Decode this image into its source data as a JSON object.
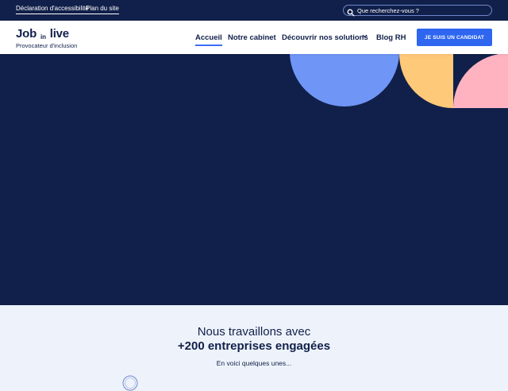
{
  "topbar": {
    "links": [
      "Déclaration d'accessibilité",
      "Plan du site"
    ],
    "search_placeholder": "Que recherchez-vous ?",
    "search_value": ""
  },
  "header": {
    "logo_word1": "Job",
    "logo_word2": "in",
    "logo_word3": "live",
    "logo_tagline": "Provocateur d'inclusion",
    "nav": [
      "Accueil",
      "Notre cabinet",
      "Découvrir nos solutions",
      "Blog RH"
    ],
    "active_nav": "Accueil",
    "cta_label": "JE SUIS UN CANDIDAT"
  },
  "partners": {
    "line1": "Nous travaillons avec",
    "line2": "+200 entreprises engagées",
    "line3": "En voici quelques unes..."
  },
  "colors": {
    "navy": "#11204a",
    "accent_blue": "#2e66f0",
    "shape_blue": "#6f96f6",
    "shape_orange": "#ffc97a",
    "shape_pink": "#ffb3c1",
    "section_bg": "#eef3fb"
  },
  "icons": {
    "search": "search-icon",
    "nav_dropdown": "chevron-down-icon",
    "partner": "partner-logo-badge"
  }
}
